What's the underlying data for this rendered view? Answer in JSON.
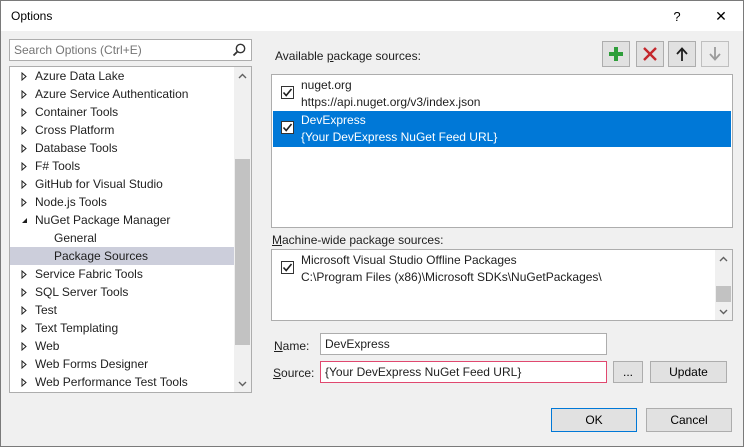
{
  "window": {
    "title": "Options",
    "help_glyph": "?",
    "close_glyph": "✕"
  },
  "search": {
    "placeholder": "Search Options (Ctrl+E)",
    "value": ""
  },
  "tree": {
    "items": [
      {
        "label": "Azure Data Lake",
        "level": 0,
        "expanded": false
      },
      {
        "label": "Azure Service Authentication",
        "level": 0,
        "expanded": false
      },
      {
        "label": "Container Tools",
        "level": 0,
        "expanded": false
      },
      {
        "label": "Cross Platform",
        "level": 0,
        "expanded": false
      },
      {
        "label": "Database Tools",
        "level": 0,
        "expanded": false
      },
      {
        "label": "F# Tools",
        "level": 0,
        "expanded": false
      },
      {
        "label": "GitHub for Visual Studio",
        "level": 0,
        "expanded": false
      },
      {
        "label": "Node.js Tools",
        "level": 0,
        "expanded": false
      },
      {
        "label": "NuGet Package Manager",
        "level": 0,
        "expanded": true
      },
      {
        "label": "General",
        "level": 1
      },
      {
        "label": "Package Sources",
        "level": 1,
        "selected": true
      },
      {
        "label": "Service Fabric Tools",
        "level": 0,
        "expanded": false
      },
      {
        "label": "SQL Server Tools",
        "level": 0,
        "expanded": false
      },
      {
        "label": "Test",
        "level": 0,
        "expanded": false
      },
      {
        "label": "Text Templating",
        "level": 0,
        "expanded": false
      },
      {
        "label": "Web",
        "level": 0,
        "expanded": false
      },
      {
        "label": "Web Forms Designer",
        "level": 0,
        "expanded": false
      },
      {
        "label": "Web Performance Test Tools",
        "level": 0,
        "expanded": false
      }
    ]
  },
  "available": {
    "label_pre": "Available ",
    "label_accel": "p",
    "label_post": "ackage sources:",
    "sources": [
      {
        "name": "nuget.org",
        "url": "https://api.nuget.org/v3/index.json",
        "checked": true,
        "selected": false
      },
      {
        "name": "DevExpress",
        "url": "{Your DevExpress NuGet Feed URL}",
        "checked": true,
        "selected": true
      }
    ]
  },
  "toolbar": {
    "add_icon": "plus-icon",
    "remove_icon": "x-icon",
    "up_icon": "arrow-up-icon",
    "down_icon": "arrow-down-icon"
  },
  "machine_wide": {
    "label_pre": "",
    "label_accel": "M",
    "label_post": "achine-wide package sources:",
    "sources": [
      {
        "name": "Microsoft Visual Studio Offline Packages",
        "url": "C:\\Program Files (x86)\\Microsoft SDKs\\NuGetPackages\\",
        "checked": true
      }
    ]
  },
  "form": {
    "name_accel": "N",
    "name_rest": "ame:",
    "name_value": "DevExpress",
    "source_accel": "S",
    "source_rest": "ource:",
    "source_value": "{Your DevExpress NuGet Feed URL}",
    "browse_label": "...",
    "update_label": "Update"
  },
  "footer": {
    "ok_label": "OK",
    "cancel_label": "Cancel"
  },
  "colors": {
    "selection": "#0078d7",
    "tree_selection": "#cccedb",
    "add_green": "#2e9e3a",
    "remove_red": "#c4272c",
    "focus_border": "#e0486f"
  }
}
